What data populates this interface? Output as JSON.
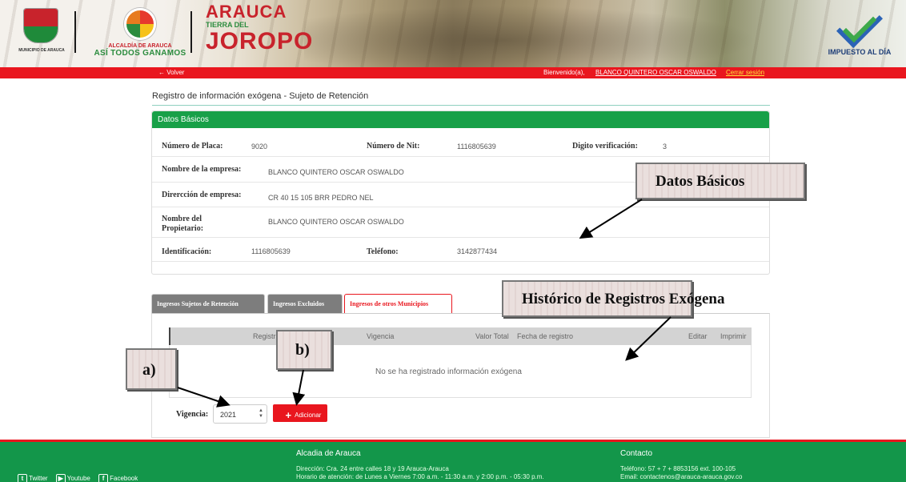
{
  "header": {
    "left_logo_caption": "MUNICIPIO DE ARAUCA",
    "alcaldia_line1": "ALCALDÍA DE ARAUCA",
    "alcaldia_line2": "ASÍ TODOS GANAMOS",
    "joropo_top": "ARAUCA",
    "joropo_mid": "TIERRA DEL",
    "joropo_bottom": "JOROPO",
    "impuesto_text": "IMPUESTO AL DÍA"
  },
  "navbar": {
    "back_label": "← Volver",
    "welcome_label": "Bienvenido(a),",
    "user_name": "BLANCO QUINTERO OSCAR OSWALDO",
    "logout_label": "Cerrar sesión"
  },
  "page_title": "Registro de información exógena - Sujeto de Retención",
  "datos_basicos": {
    "panel_title": "Datos Básicos",
    "placa_label": "Número de Placa:",
    "placa_value": "9020",
    "nit_label": "Número de Nit:",
    "nit_value": "1116805639",
    "digito_label": "Digito verificación:",
    "digito_value": "3",
    "empresa_label": "Nombre de la empresa:",
    "empresa_value": "BLANCO QUINTERO OSCAR OSWALDO",
    "direccion_label": "Dirercción de empresa:",
    "direccion_value": "CR 40 15 105 BRR PEDRO NEL",
    "propietario_label_1": "Nombre del",
    "propietario_label_2": "Propietario:",
    "propietario_value": "BLANCO QUINTERO OSCAR  OSWALDO",
    "identificacion_label": "Identificación:",
    "identificacion_value": "1116805639",
    "telefono_label": "Teléfono:",
    "telefono_value": "3142877434"
  },
  "callouts": {
    "datos": "Datos Básicos",
    "historico": "Histórico de Registros Exógena",
    "a": "a)",
    "b": "b)"
  },
  "tabs": [
    {
      "label": "Ingresos Sujetos de Retención"
    },
    {
      "label": "Ingresos Excluidos"
    },
    {
      "label": "Ingresos de otros Municipios"
    }
  ],
  "grid": {
    "columns": [
      "Registr",
      "Vigencia",
      "Valor Total",
      "Fecha de registro",
      "Editar",
      "Imprimir"
    ],
    "empty_message": "No se ha registrado información exógena"
  },
  "vigencia": {
    "label": "Vigencia:",
    "value": "2021"
  },
  "add_button": {
    "label": "Adicionar"
  },
  "footer": {
    "social": [
      "Twitter",
      "Youtube",
      "Facebook"
    ],
    "col1_title": "Alcadia de Arauca",
    "col1_line1": "Dirección: Cra. 24 entre calles 18 y 19 Arauca-Arauca",
    "col1_line2": "Horario de atención: de Lunes a Viernes 7:00 a.m. - 11:30 a.m. y 2:00 p.m. - 05:30 p.m.",
    "col2_title": "Contacto",
    "col2_line1": "Teléfono: 57 + 7 + 8853156 ext. 100-105",
    "col2_line2": "Email: contactenos@arauca-arauca.gov.co"
  },
  "colors": {
    "primary_red": "#e9161e",
    "primary_green": "#18a048",
    "footer_green": "#13964a"
  }
}
